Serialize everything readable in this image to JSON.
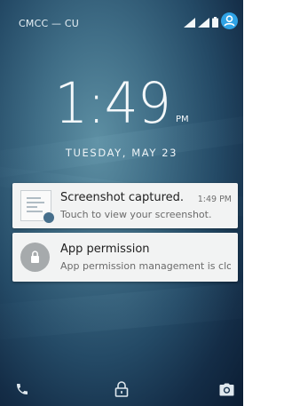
{
  "status_bar": {
    "carrier": "CMCC — CU",
    "icons": [
      "signal-icon",
      "signal-icon",
      "battery-icon",
      "account-icon"
    ]
  },
  "clock": {
    "time": "1:49",
    "ampm": "PM",
    "date": "TUESDAY, MAY 23"
  },
  "notifications": [
    {
      "icon": "screenshot-thumbnail",
      "title": "Screenshot captured.",
      "time": "1:49 PM",
      "text": "Touch to view your screenshot."
    },
    {
      "icon": "lock-icon",
      "title": "App permission",
      "text": "App permission management is clo..."
    }
  ],
  "bottom_bar": {
    "icons": [
      "phone-icon",
      "lock-icon",
      "camera-icon"
    ]
  },
  "colors": {
    "accent": "#2fa3e6",
    "card": "#f2f3f3"
  }
}
